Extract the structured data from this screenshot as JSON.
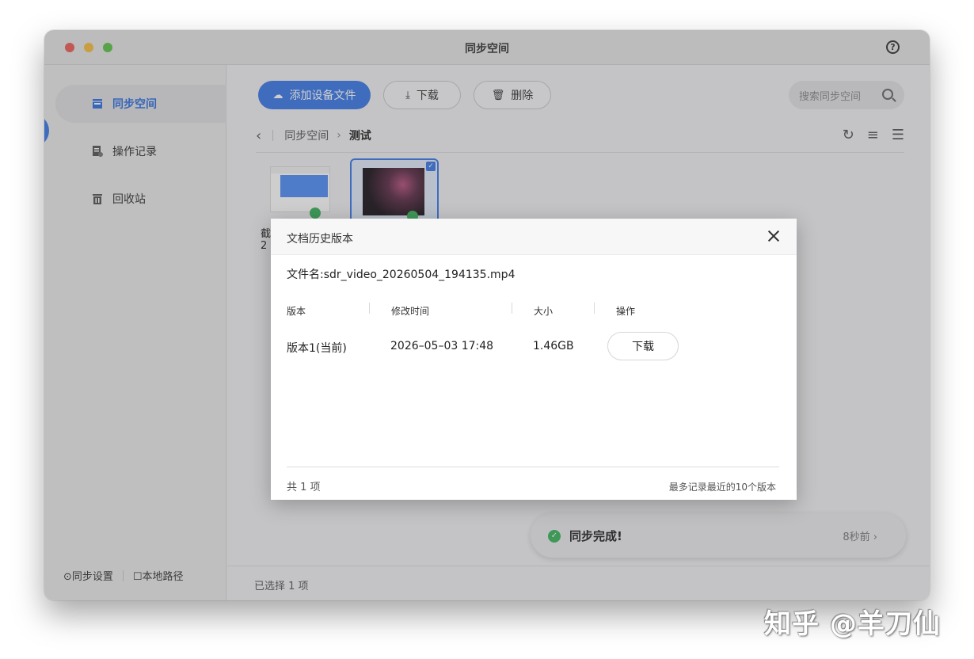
{
  "window": {
    "title": "同步空间",
    "help": "?"
  },
  "sidebar": {
    "items": [
      {
        "label": "同步空间",
        "icon": "folder-icon"
      },
      {
        "label": "操作记录",
        "icon": "record-icon"
      },
      {
        "label": "回收站",
        "icon": "trash-icon"
      }
    ],
    "bottom": {
      "settings": "⊙同步设置",
      "local_path": "☐本地路径"
    }
  },
  "toolbar": {
    "add_label": "添加设备文件",
    "download_label": "下载",
    "delete_label": "删除",
    "search_placeholder": "搜索同步空间"
  },
  "breadcrumb": {
    "root": "同步空间",
    "current": "测试"
  },
  "files": [
    {
      "name_fragment": "截",
      "sub_fragment": "2"
    },
    {
      "name_fragment": "",
      "sub_fragment": ""
    }
  ],
  "footer": {
    "selected": "已选择 1 项"
  },
  "toast": {
    "text": "同步完成!",
    "time": "8秒前 ›"
  },
  "dialog": {
    "title": "文档历史版本",
    "file_name": "文件名:sdr_video_20260504_194135.mp4",
    "columns": [
      "版本",
      "修改时间",
      "大小",
      "操作"
    ],
    "rows": [
      {
        "version": "版本1(当前)",
        "modified": "2026–05–03 17:48",
        "size": "1.46GB",
        "action": "下载"
      }
    ],
    "count": "共 1 项",
    "note": "最多记录最近的10个版本"
  },
  "watermark": "知乎 @羊刀仙",
  "colors": {
    "accent": "#3b78e7",
    "success": "#3ab35a"
  }
}
